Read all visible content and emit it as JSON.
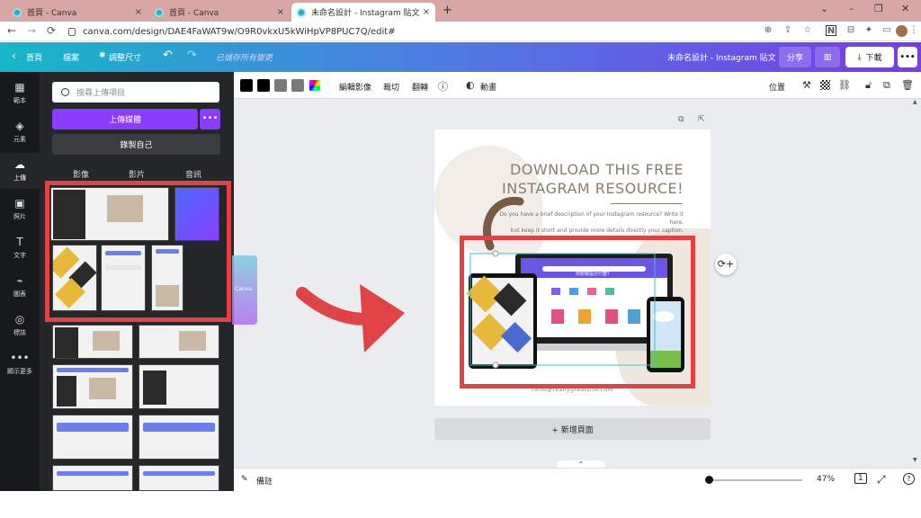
{
  "browser": {
    "tabs": [
      {
        "title": "首頁 - Canva",
        "close": "×"
      },
      {
        "title": "首頁 - Canva",
        "close": "×"
      },
      {
        "title": "未命名設計 - Instagram 貼文",
        "close": "×"
      }
    ],
    "new_tab": "+",
    "window_controls": {
      "down": "⌄",
      "minimize": "–",
      "maximize": "❐",
      "close": "✕"
    },
    "nav": {
      "back": "←",
      "forward": "→",
      "reload": "⟳"
    },
    "url": "canva.com/design/DAE4FaWAT9w/O9R0vkxU5kWiHpVP8PUC7Q/edit#",
    "icons": {
      "zoom": "⊕",
      "share": "⇪",
      "star": "☆",
      "notion": "N",
      "ext2": "⊟",
      "puzzle": "✦",
      "sidebar": "▭",
      "menu": "⋮"
    }
  },
  "header": {
    "home": "首頁",
    "home_chevron": "‹",
    "file": "檔案",
    "resize_icon": "✱",
    "resize": "調整尺寸",
    "undo": "↶",
    "redo": "↷",
    "saved": "已儲存所有變更",
    "doc_title": "未命名設計 - Instagram 貼文",
    "share": "分享",
    "stats_icon": "▥",
    "download_icon": "⤓",
    "download": "下載",
    "more": "•••"
  },
  "rail": [
    {
      "icon": "▦",
      "label": "範本"
    },
    {
      "icon": "◈",
      "label": "元素"
    },
    {
      "icon": "☁",
      "label": "上傳"
    },
    {
      "icon": "▣",
      "label": "照片"
    },
    {
      "icon": "T",
      "label": "文字"
    },
    {
      "icon": "⌁",
      "label": "圖表"
    },
    {
      "icon": "◎",
      "label": "標誌"
    },
    {
      "icon": "•••",
      "label": "顯示更多"
    }
  ],
  "panel": {
    "search_placeholder": "搜尋上傳項目",
    "upload": "上傳媒體",
    "upload_more": "•••",
    "record": "錄製自己",
    "tabs": [
      "影像",
      "影片",
      "音訊"
    ],
    "drag_label": "Canva"
  },
  "toolbar": {
    "swatches": [
      "#000000",
      "#000000",
      "#7a7a7a",
      "#7a7a7a"
    ],
    "rainbow": "rainbow-swatch",
    "edit_image": "編輯影像",
    "crop": "裁切",
    "flip": "翻轉",
    "info": "ⓘ",
    "animate_icon": "◐",
    "animate": "動畫",
    "position": "位置",
    "paint": "⚒",
    "link": "⛓",
    "lock": "🔓︎",
    "dup": "⧉",
    "trash": "🗑︎"
  },
  "design": {
    "headline_1": "DOWNLOAD THIS FREE",
    "headline_2": "INSTAGRAM RESOURCE!",
    "description_1": "Do you have a brief description of your Instagram resource? Write it here,",
    "description_2": "but keep it short and provide more details directly your caption.",
    "email": "hello@reallygreatsite.com",
    "monitor_text": "你想要設計什麼？",
    "page_icons": {
      "copy": "⧉",
      "export": "⇱"
    }
  },
  "canvas_ui": {
    "add_page": "+ 新增頁面",
    "float_icon": "⟳+"
  },
  "bottom": {
    "notes_icon": "✎",
    "notes": "備註",
    "zoom": "47%",
    "page_icon": "1",
    "fullscreen": "⤢",
    "help": "?",
    "collapse": "⌃"
  },
  "colors": {
    "highlight": "#e04343",
    "arrow": "#e04343",
    "canva_purple": "#8b3dff",
    "headline": "#8b7b6d"
  }
}
